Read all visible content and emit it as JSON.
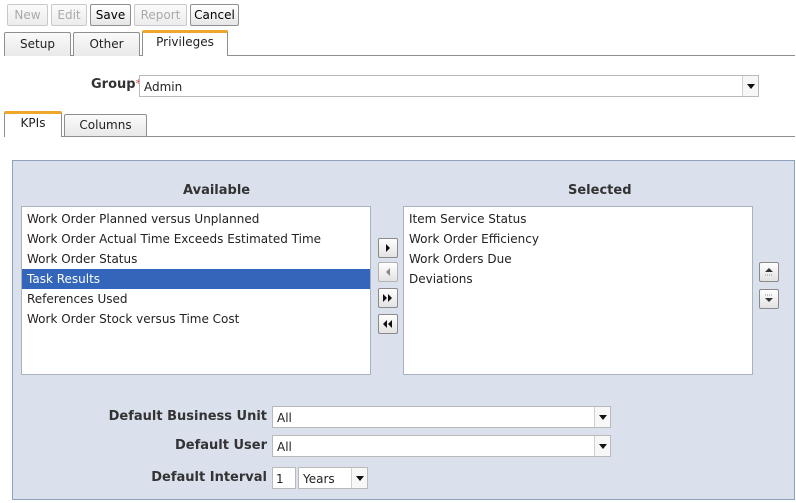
{
  "toolbar": {
    "new_label": "New",
    "edit_label": "Edit",
    "save_label": "Save",
    "report_label": "Report",
    "cancel_label": "Cancel"
  },
  "main_tabs": [
    {
      "label": "Setup"
    },
    {
      "label": "Other"
    },
    {
      "label": "Privileges",
      "active": true
    }
  ],
  "group": {
    "label": "Group",
    "required_marker": "*",
    "value": "Admin"
  },
  "sub_tabs": [
    {
      "label": "KPIs",
      "active": true
    },
    {
      "label": "Columns"
    }
  ],
  "available": {
    "title": "Available",
    "items": [
      "Work Order Planned versus Unplanned",
      "Work Order Actual Time Exceeds Estimated Time",
      "Work Order Status",
      "Task Results",
      "References Used",
      "Work Order Stock versus Time Cost"
    ],
    "selected_index": 3
  },
  "selected": {
    "title": "Selected",
    "items": [
      "Item Service Status",
      "Work Order Efficiency",
      "Work Orders Due",
      "Deviations"
    ]
  },
  "defaults": {
    "business_unit_label": "Default Business Unit",
    "business_unit_value": "All",
    "user_label": "Default User",
    "user_value": "All",
    "interval_label": "Default Interval",
    "interval_number": "1",
    "interval_unit": "Years"
  },
  "colors": {
    "accent_tab": "#f0a62a",
    "selection": "#3366bb",
    "panel_bg": "#dae1ec"
  }
}
